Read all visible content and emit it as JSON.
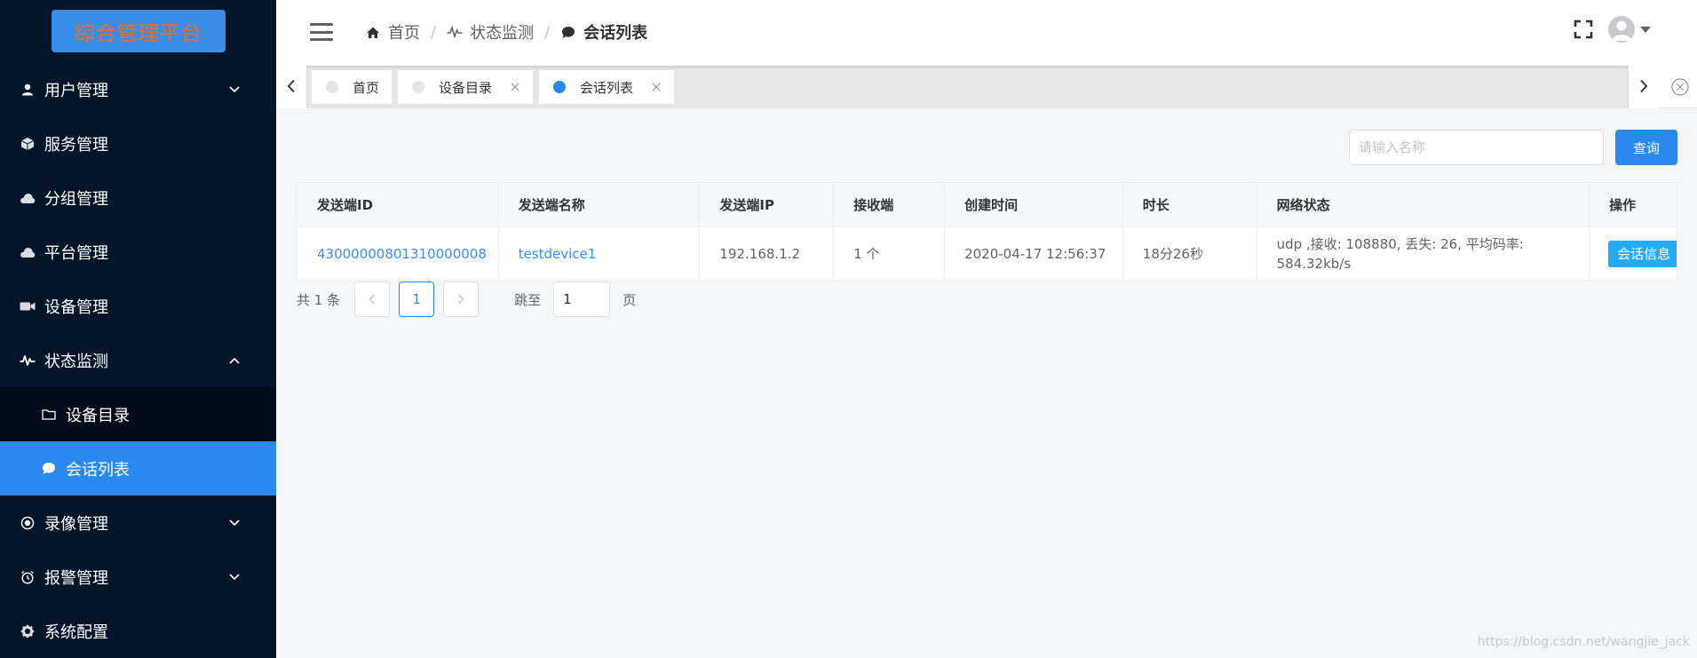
{
  "app": {
    "logo_text": "综合管理平台"
  },
  "sidebar": {
    "items": [
      {
        "label": "用户管理",
        "icon": "user-icon",
        "arrow": "down"
      },
      {
        "label": "服务管理",
        "icon": "box-icon"
      },
      {
        "label": "分组管理",
        "icon": "cloud-icon"
      },
      {
        "label": "平台管理",
        "icon": "cloud-icon"
      },
      {
        "label": "设备管理",
        "icon": "video-camera-icon"
      },
      {
        "label": "状态监测",
        "icon": "pulse-icon",
        "arrow": "up"
      },
      {
        "label": "录像管理",
        "icon": "record-icon",
        "arrow": "down"
      },
      {
        "label": "报警管理",
        "icon": "alarm-clock-icon",
        "arrow": "down"
      },
      {
        "label": "系统配置",
        "icon": "gear-icon"
      }
    ],
    "submenu": [
      {
        "label": "设备目录",
        "icon": "folder-icon"
      },
      {
        "label": "会话列表",
        "icon": "chat-bubble-icon",
        "active": true
      }
    ]
  },
  "header": {
    "breadcrumb": [
      {
        "label": "首页",
        "icon": "home-icon"
      },
      {
        "label": "状态监测",
        "icon": "pulse-icon"
      },
      {
        "label": "会话列表",
        "icon": "chat-bubble-icon"
      }
    ],
    "separator": "/"
  },
  "tabs": [
    {
      "label": "首页",
      "closable": false
    },
    {
      "label": "设备目录",
      "closable": true
    },
    {
      "label": "会话列表",
      "closable": true,
      "active": true
    }
  ],
  "search": {
    "placeholder": "请输入名称",
    "button_label": "查询"
  },
  "table": {
    "columns": [
      "发送端ID",
      "发送端名称",
      "发送端IP",
      "接收端",
      "创建时间",
      "时长",
      "网络状态",
      "操作"
    ],
    "rows": [
      {
        "id": "43000000801310000008",
        "name": "testdevice1",
        "ip": "192.168.1.2",
        "receivers": "1 个",
        "created": "2020-04-17 12:56:37",
        "duration": "18分26秒",
        "network": "udp ,接收: 108880, 丢失: 26, 平均码率: 584.32kb/s",
        "action_label": "会话信息"
      }
    ]
  },
  "pagination": {
    "total_text": "共 1 条",
    "current_page": "1",
    "jump_label": "跳至",
    "jump_value": "1",
    "page_suffix": "页"
  },
  "watermark": "https://blog.csdn.net/wangjie_jack",
  "colors": {
    "sidebar_bg": "#031528",
    "accent": "#2b89ee",
    "logo_bg": "#3a8ee6",
    "logo_text": "#f06b2b",
    "action_button": "#27aaf6"
  }
}
